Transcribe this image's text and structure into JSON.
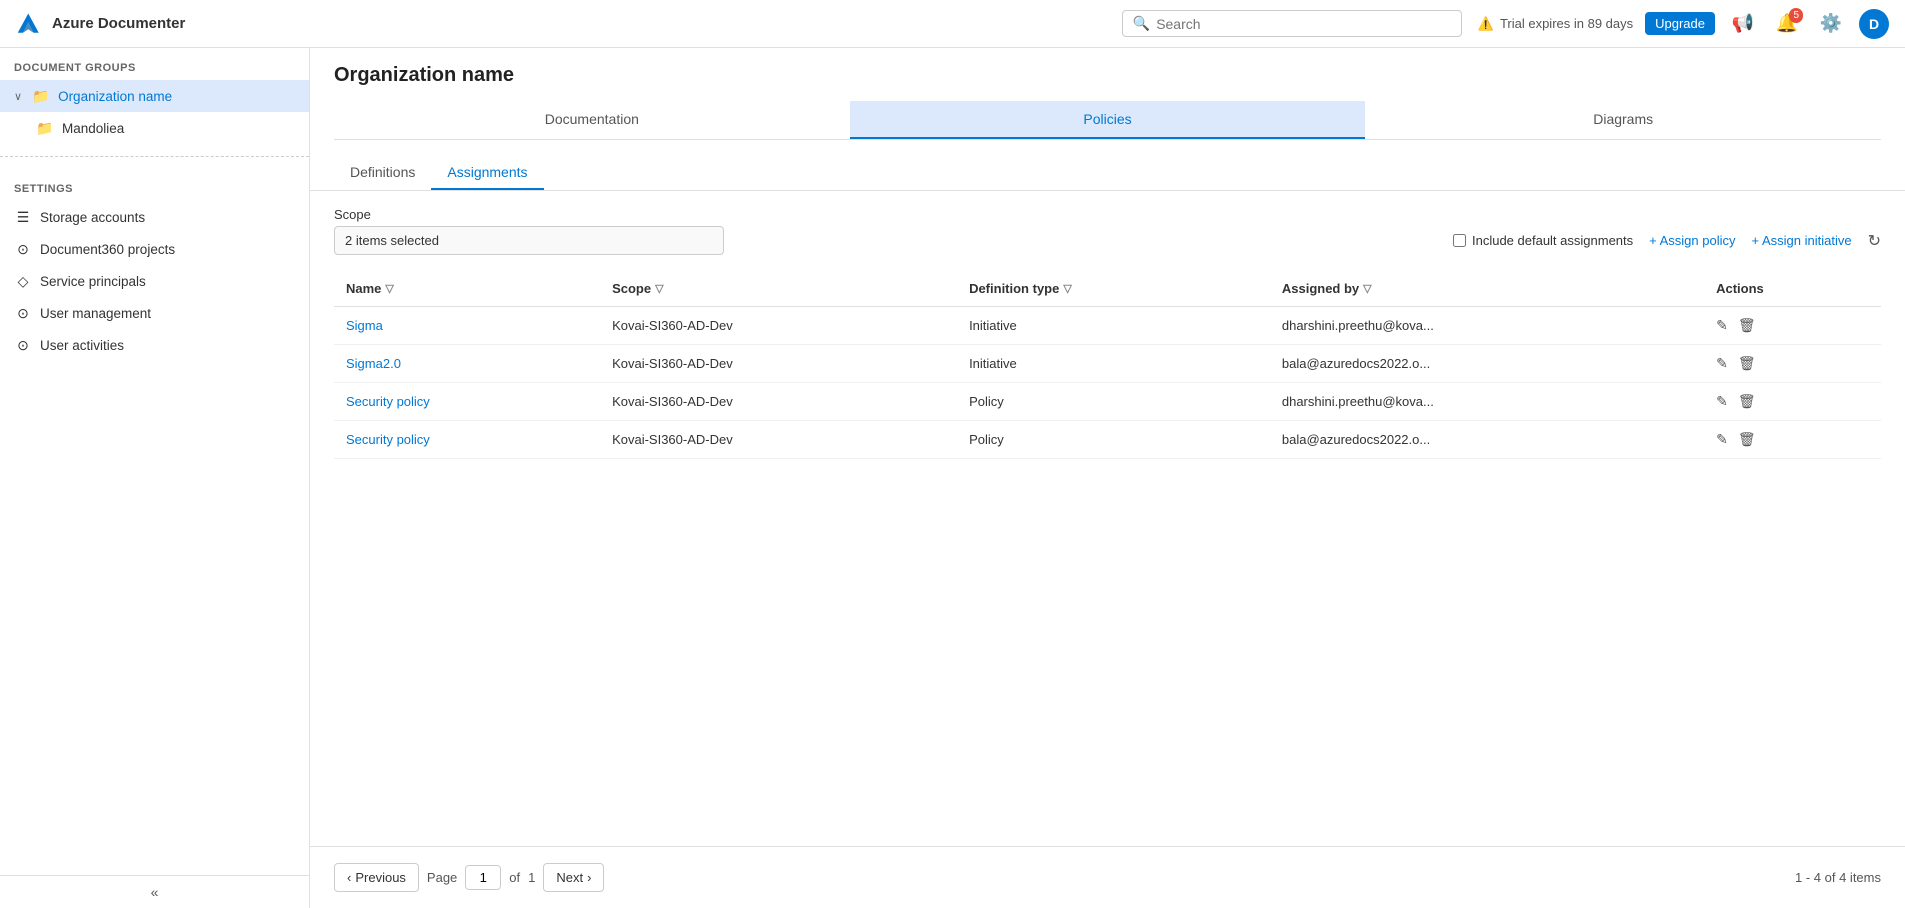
{
  "brand": {
    "name": "Azure Documenter"
  },
  "navbar": {
    "search_placeholder": "Search",
    "trial_text": "Trial expires in 89 days",
    "upgrade_label": "Upgrade",
    "bell_badge": "5",
    "avatar_letter": "D"
  },
  "sidebar": {
    "section_label": "DOCUMENT GROUPS",
    "org_name": "Organization name",
    "child_item": "Mandoliea",
    "settings_label": "SETTINGS",
    "settings_items": [
      {
        "label": "Storage accounts",
        "icon": "☰"
      },
      {
        "label": "Document360 projects",
        "icon": "⊙"
      },
      {
        "label": "Service principals",
        "icon": "◇"
      },
      {
        "label": "User management",
        "icon": "⊙"
      },
      {
        "label": "User activities",
        "icon": "⊙"
      }
    ]
  },
  "content": {
    "page_title": "Organization name",
    "main_tabs": [
      {
        "label": "Documentation"
      },
      {
        "label": "Policies"
      },
      {
        "label": "Diagrams"
      }
    ],
    "active_main_tab": 1,
    "sub_tabs": [
      {
        "label": "Definitions"
      },
      {
        "label": "Assignments"
      }
    ],
    "active_sub_tab": 1,
    "scope_label": "Scope",
    "scope_value": "2 items selected",
    "include_default_label": "Include default assignments",
    "assign_policy_label": "+ Assign policy",
    "assign_initiative_label": "+ Assign initiative",
    "table": {
      "columns": [
        {
          "label": "Name",
          "filterable": true
        },
        {
          "label": "Scope",
          "filterable": true
        },
        {
          "label": "Definition type",
          "filterable": true
        },
        {
          "label": "Assigned by",
          "filterable": true
        },
        {
          "label": "Actions",
          "filterable": false
        }
      ],
      "rows": [
        {
          "name": "Sigma",
          "scope": "Kovai-SI360-AD-Dev",
          "definition_type": "Initiative",
          "assigned_by": "dharshini.preethu@kova..."
        },
        {
          "name": "Sigma2.0",
          "scope": "Kovai-SI360-AD-Dev",
          "definition_type": "Initiative",
          "assigned_by": "bala@azuredocs2022.o..."
        },
        {
          "name": "Security policy",
          "scope": "Kovai-SI360-AD-Dev",
          "definition_type": "Policy",
          "assigned_by": "dharshini.preethu@kova..."
        },
        {
          "name": "Security policy",
          "scope": "Kovai-SI360-AD-Dev",
          "definition_type": "Policy",
          "assigned_by": "bala@azuredocs2022.o..."
        }
      ]
    },
    "pagination": {
      "previous_label": "Previous",
      "next_label": "Next",
      "page_label": "Page",
      "current_page": "1",
      "of_label": "of",
      "total_pages": "1",
      "items_summary": "1 - 4 of 4 items"
    }
  }
}
